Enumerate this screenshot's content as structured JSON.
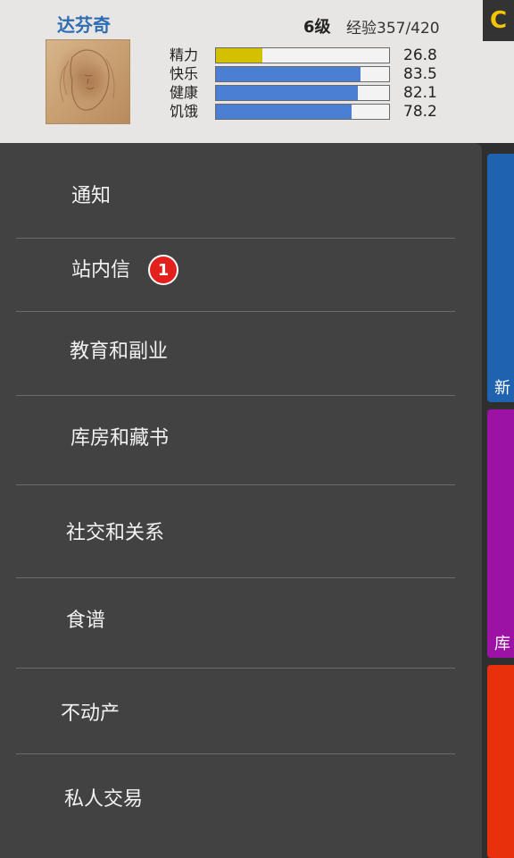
{
  "profile": {
    "name": "达芬奇",
    "level": "6级",
    "experience": "经验357/420",
    "corner_button": "C"
  },
  "stats": [
    {
      "label": "精力",
      "value": "26.8",
      "fraction": 0.268,
      "color": "#d4bf00"
    },
    {
      "label": "快乐",
      "value": "83.5",
      "fraction": 0.835,
      "color": "#4a7fd4"
    },
    {
      "label": "健康",
      "value": "82.1",
      "fraction": 0.821,
      "color": "#4a7fd4"
    },
    {
      "label": "饥饿",
      "value": "78.2",
      "fraction": 0.782,
      "color": "#4a7fd4"
    }
  ],
  "side_tabs": [
    {
      "label": "新",
      "color": "#1f63b0"
    },
    {
      "label": "库",
      "color": "#9b12a5"
    },
    {
      "label": "",
      "color": "#e8300c"
    }
  ],
  "menu": [
    {
      "label": "通知"
    },
    {
      "label": "站内信",
      "badge": "1"
    },
    {
      "label": "教育和副业"
    },
    {
      "label": "库房和藏书"
    },
    {
      "label": "社交和关系"
    },
    {
      "label": "食谱"
    },
    {
      "label": "不动产"
    },
    {
      "label": "私人交易"
    }
  ]
}
